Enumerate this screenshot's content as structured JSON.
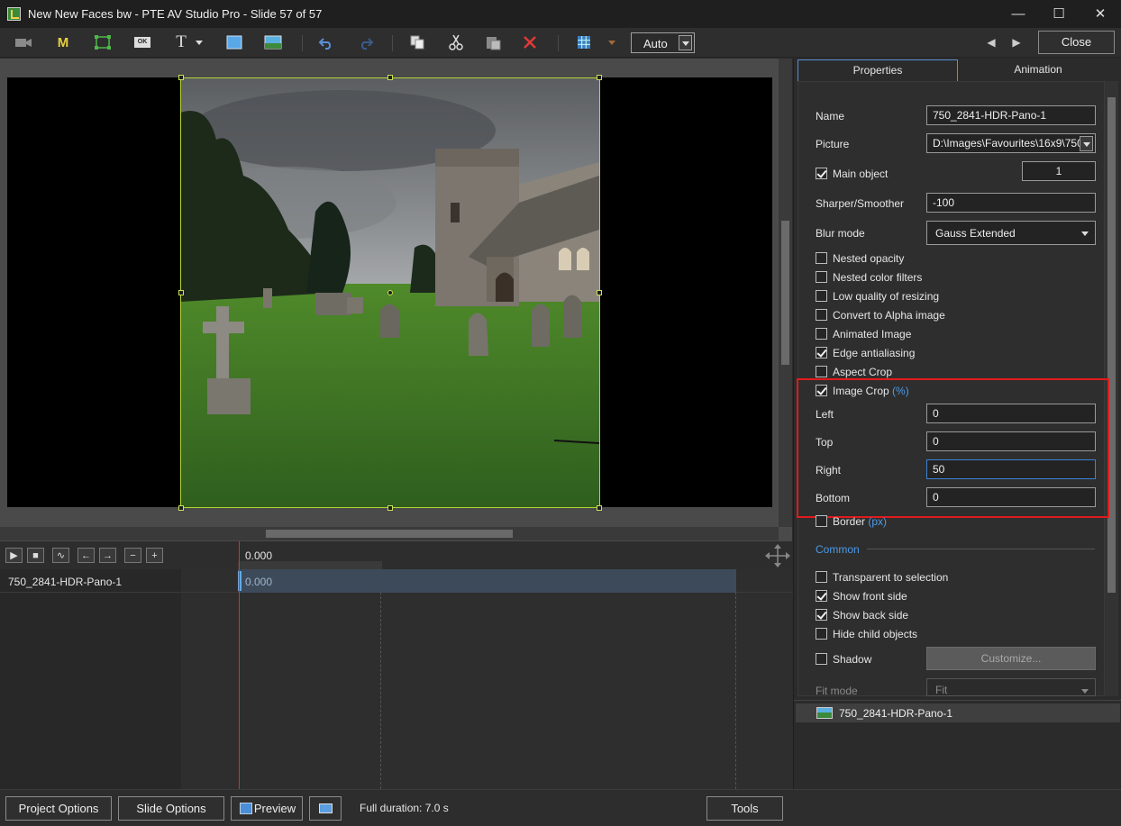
{
  "window": {
    "title": "New New Faces bw - PTE AV Studio Pro - Slide 57 of 57",
    "minimize": "—",
    "maximize": "☐",
    "close": "✕"
  },
  "toolbar": {
    "m_label": "M",
    "t_label": "T",
    "ok_label": "OK",
    "zoom_value": "Auto",
    "close_label": "Close"
  },
  "timeline": {
    "time": "0.000",
    "bar_time": "0.000",
    "row_name": "750_2841-HDR-Pano-1"
  },
  "bottom": {
    "project_options": "Project Options",
    "slide_options": "Slide Options",
    "preview": "Preview",
    "duration": "Full duration: 7.0 s",
    "tools": "Tools"
  },
  "panel": {
    "tabs": [
      "Properties",
      "Animation"
    ],
    "name_label": "Name",
    "name_value": "750_2841-HDR-Pano-1",
    "picture_label": "Picture",
    "picture_value": "D:\\Images\\Favourites\\16x9\\750",
    "main_object_label": "Main object",
    "main_object_value": "1",
    "sharper_label": "Sharper/Smoother",
    "sharper_value": "-100",
    "blur_label": "Blur mode",
    "blur_value": "Gauss Extended",
    "checkboxes": [
      {
        "label": "Nested opacity",
        "checked": false
      },
      {
        "label": "Nested color filters",
        "checked": false
      },
      {
        "label": "Low quality of resizing",
        "checked": false
      },
      {
        "label": "Convert to Alpha image",
        "checked": false
      },
      {
        "label": "Animated Image",
        "checked": false
      },
      {
        "label": "Edge antialiasing",
        "checked": true
      },
      {
        "label": "Aspect Crop",
        "checked": false
      }
    ],
    "image_crop_label": "Image Crop",
    "image_crop_unit": "(%)",
    "crop": {
      "left_label": "Left",
      "left_value": "0",
      "top_label": "Top",
      "top_value": "0",
      "right_label": "Right",
      "right_value": "50",
      "bottom_label": "Bottom",
      "bottom_value": "0"
    },
    "border_label": "Border",
    "border_unit": "(px)",
    "common_label": "Common",
    "common_checkboxes": [
      {
        "label": "Transparent to selection",
        "checked": false
      },
      {
        "label": "Show front side",
        "checked": true
      },
      {
        "label": "Show back side",
        "checked": true
      },
      {
        "label": "Hide child objects",
        "checked": false
      }
    ],
    "shadow_label": "Shadow",
    "customize_label": "Customize...",
    "fit_mode_label": "Fit mode",
    "fit_mode_value": "Fit",
    "object_item": "750_2841-HDR-Pano-1"
  },
  "colors": {
    "selection_frame": "#b5d334",
    "highlight": "#e01b1b",
    "accent": "#4a9be8",
    "playhead": "#d03030"
  }
}
